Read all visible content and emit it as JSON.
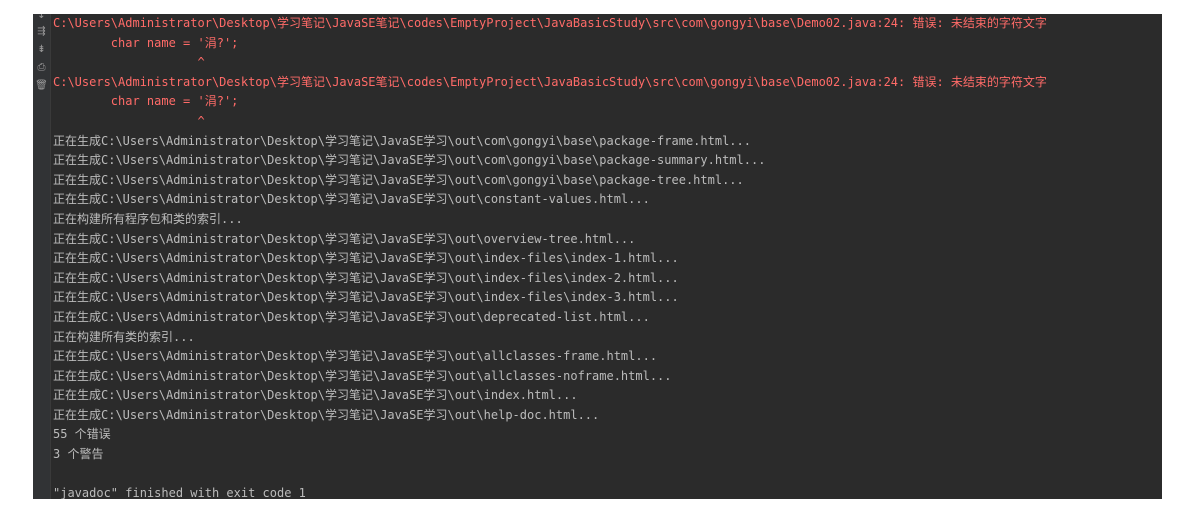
{
  "console": {
    "lines": [
      {
        "type": "error",
        "text": "C:\\Users\\Administrator\\Desktop\\学习笔记\\JavaSE笔记\\codes\\EmptyProject\\JavaBasicStudy\\src\\com\\gongyi\\base\\Demo02.java:24: 错误: 未结束的字符文字"
      },
      {
        "type": "error",
        "text": "        char name = '涓?';"
      },
      {
        "type": "error",
        "text": "                    ^"
      },
      {
        "type": "error",
        "text": "C:\\Users\\Administrator\\Desktop\\学习笔记\\JavaSE笔记\\codes\\EmptyProject\\JavaBasicStudy\\src\\com\\gongyi\\base\\Demo02.java:24: 错误: 未结束的字符文字"
      },
      {
        "type": "error",
        "text": "        char name = '涓?';"
      },
      {
        "type": "error",
        "text": "                    ^"
      },
      {
        "type": "normal",
        "text": "正在生成C:\\Users\\Administrator\\Desktop\\学习笔记\\JavaSE学习\\out\\com\\gongyi\\base\\package-frame.html..."
      },
      {
        "type": "normal",
        "text": "正在生成C:\\Users\\Administrator\\Desktop\\学习笔记\\JavaSE学习\\out\\com\\gongyi\\base\\package-summary.html..."
      },
      {
        "type": "normal",
        "text": "正在生成C:\\Users\\Administrator\\Desktop\\学习笔记\\JavaSE学习\\out\\com\\gongyi\\base\\package-tree.html..."
      },
      {
        "type": "normal",
        "text": "正在生成C:\\Users\\Administrator\\Desktop\\学习笔记\\JavaSE学习\\out\\constant-values.html..."
      },
      {
        "type": "normal",
        "text": "正在构建所有程序包和类的索引..."
      },
      {
        "type": "normal",
        "text": "正在生成C:\\Users\\Administrator\\Desktop\\学习笔记\\JavaSE学习\\out\\overview-tree.html..."
      },
      {
        "type": "normal",
        "text": "正在生成C:\\Users\\Administrator\\Desktop\\学习笔记\\JavaSE学习\\out\\index-files\\index-1.html..."
      },
      {
        "type": "normal",
        "text": "正在生成C:\\Users\\Administrator\\Desktop\\学习笔记\\JavaSE学习\\out\\index-files\\index-2.html..."
      },
      {
        "type": "normal",
        "text": "正在生成C:\\Users\\Administrator\\Desktop\\学习笔记\\JavaSE学习\\out\\index-files\\index-3.html..."
      },
      {
        "type": "normal",
        "text": "正在生成C:\\Users\\Administrator\\Desktop\\学习笔记\\JavaSE学习\\out\\deprecated-list.html..."
      },
      {
        "type": "normal",
        "text": "正在构建所有类的索引..."
      },
      {
        "type": "normal",
        "text": "正在生成C:\\Users\\Administrator\\Desktop\\学习笔记\\JavaSE学习\\out\\allclasses-frame.html..."
      },
      {
        "type": "normal",
        "text": "正在生成C:\\Users\\Administrator\\Desktop\\学习笔记\\JavaSE学习\\out\\allclasses-noframe.html..."
      },
      {
        "type": "normal",
        "text": "正在生成C:\\Users\\Administrator\\Desktop\\学习笔记\\JavaSE学习\\out\\index.html..."
      },
      {
        "type": "normal",
        "text": "正在生成C:\\Users\\Administrator\\Desktop\\学习笔记\\JavaSE学习\\out\\help-doc.html..."
      },
      {
        "type": "normal",
        "text": "55 个错误"
      },
      {
        "type": "normal",
        "text": "3 个警告"
      },
      {
        "type": "blank",
        "text": ""
      },
      {
        "type": "normal",
        "text": "\"javadoc\" finished with exit code 1"
      }
    ]
  },
  "gutter": {
    "icons": [
      {
        "name": "scroll-down-icon",
        "glyph": "↓"
      },
      {
        "name": "soft-wrap-icon",
        "glyph": "⇶"
      },
      {
        "name": "scroll-to-end-icon",
        "glyph": "⇟"
      },
      {
        "name": "print-icon",
        "glyph": "⎙"
      },
      {
        "name": "clear-all-icon",
        "glyph": "🗑"
      }
    ]
  },
  "colors": {
    "background": "#2b2b2b",
    "error_text": "#ff6b68",
    "normal_text": "#bbbbbb"
  }
}
